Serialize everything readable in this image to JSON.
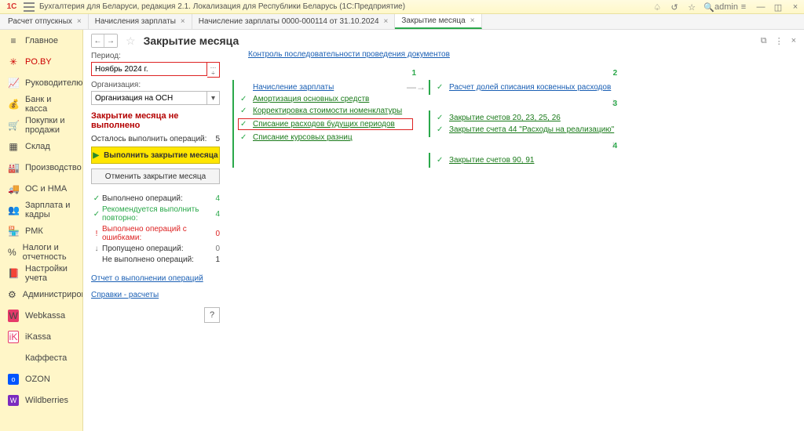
{
  "titlebar": {
    "logo_text": "1C",
    "title": "Бухгалтерия для Беларуси, редакция 2.1. Локализация для Республики Беларусь   (1С:Предприятие)",
    "user": "admin"
  },
  "tabs": [
    {
      "label": "Расчет отпускных",
      "active": false
    },
    {
      "label": "Начисления зарплаты",
      "active": false
    },
    {
      "label": "Начисление зарплаты 0000-000114 от 31.10.2024",
      "active": false
    },
    {
      "label": "Закрытие месяца",
      "active": true
    }
  ],
  "sidebar": {
    "items": [
      {
        "icon": "≡",
        "label": "Главное"
      },
      {
        "icon": "✳",
        "label": "PO.BY",
        "cls": "active"
      },
      {
        "icon": "📈",
        "label": "Руководителю"
      },
      {
        "icon": "💰",
        "label": "Банк и касса"
      },
      {
        "icon": "🛒",
        "label": "Покупки и продажи"
      },
      {
        "icon": "▦",
        "label": "Склад"
      },
      {
        "icon": "🏭",
        "label": "Производство"
      },
      {
        "icon": "🚚",
        "label": "ОС и НМА"
      },
      {
        "icon": "👥",
        "label": "Зарплата и кадры"
      },
      {
        "icon": "🏪",
        "label": "РМК"
      },
      {
        "icon": "%",
        "label": "Налоги и отчетность"
      },
      {
        "icon": "📕",
        "label": "Настройки учета"
      },
      {
        "icon": "⚙",
        "label": "Администрирование"
      },
      {
        "icon": "W",
        "label": "Webkassa",
        "cls": "web"
      },
      {
        "icon": "iK",
        "label": "iKassa",
        "cls": "ik"
      },
      {
        "icon": " ",
        "label": "Каффеста",
        "cls": "kaf"
      },
      {
        "icon": "o",
        "label": "OZON",
        "cls": "ozon"
      },
      {
        "icon": "W",
        "label": "Wildberries",
        "cls": "wb"
      }
    ]
  },
  "page": {
    "title": "Закрытие месяца",
    "period_label": "Период:",
    "period_value": "Ноябрь 2024 г.",
    "org_label": "Организация:",
    "org_value": "Организация на ОСН",
    "status_bold": "Закрытие месяца не выполнено",
    "remain_label": "Осталось выполнить операций:",
    "remain_value": "5",
    "btn_run": "Выполнить закрытие месяца",
    "btn_cancel": "Отменить закрытие месяца",
    "stats": [
      {
        "mark": "✓",
        "cls": "green",
        "txt": "Выполнено операций:",
        "num": "4"
      },
      {
        "mark": "✓",
        "cls": "green",
        "txt": "Рекомендуется выполнить повторно:",
        "txtcls": "green",
        "num": "4"
      },
      {
        "mark": "!",
        "cls": "red",
        "txt": "Выполнено операций с ошибками:",
        "txtcls": "red",
        "num": "0"
      },
      {
        "mark": "↓",
        "cls": "grey",
        "txt": "Пропущено операций:",
        "num": "0"
      },
      {
        "mark": "",
        "cls": "",
        "txt": "Не выполнено операций:",
        "num": "1"
      }
    ],
    "link_report": "Отчет о выполнении операций",
    "link_calc": "Справки - расчеты",
    "top_link": "Контроль последовательности проведения документов",
    "stage1_ops": [
      {
        "label": "Начисление зарплаты",
        "nochk": true,
        "blue": true
      },
      {
        "label": "Амортизация основных средств"
      },
      {
        "label": "Корректировка стоимости номенклатуры"
      },
      {
        "label": "Списание расходов будущих периодов",
        "hl": true
      },
      {
        "label": "Списание курсовых разниц"
      }
    ],
    "stage2_ops": [
      {
        "label": "Расчет долей списания косвенных расходов",
        "blue": true
      }
    ],
    "stage3_ops": [
      {
        "label": "Закрытие счетов 20, 23, 25, 26"
      },
      {
        "label": "Закрытие счета 44 \"Расходы на реализацию\""
      }
    ],
    "stage4_ops": [
      {
        "label": "Закрытие счетов 90, 91"
      }
    ]
  }
}
